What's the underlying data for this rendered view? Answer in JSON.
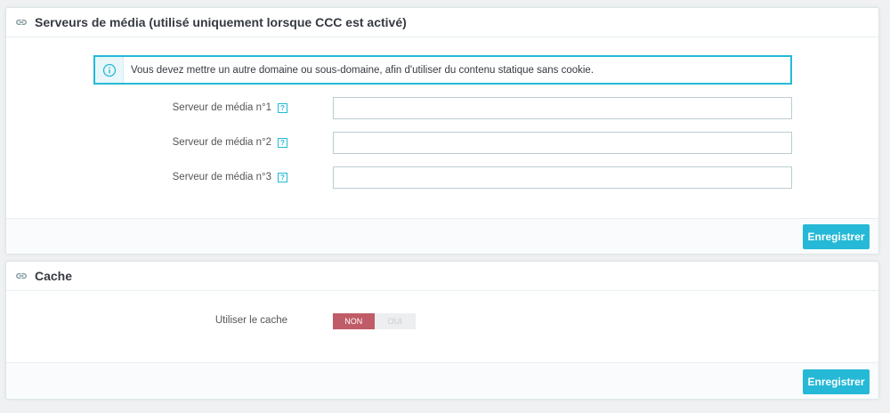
{
  "media_servers": {
    "title": "Serveurs de média (utilisé uniquement lorsque CCC est activé)",
    "alert": "Vous devez mettre un autre domaine ou sous-domaine, afin d'utiliser du contenu statique sans cookie.",
    "fields": [
      {
        "label": "Serveur de média n°1",
        "help": "?",
        "value": ""
      },
      {
        "label": "Serveur de média n°2",
        "help": "?",
        "value": ""
      },
      {
        "label": "Serveur de média n°3",
        "help": "?",
        "value": ""
      }
    ],
    "save_label": "Enregistrer"
  },
  "cache": {
    "title": "Cache",
    "use_cache_label": "Utiliser le cache",
    "switch_off": "NON",
    "switch_on": "OUI",
    "selected": "NON",
    "save_label": "Enregistrer"
  },
  "colors": {
    "accent": "#25b9d7",
    "switch_off_active": "#c05c67",
    "background": "#eff1f2"
  },
  "icons": {
    "panel_head": "link-icon",
    "alert": "info-icon",
    "field_help": "help-icon"
  }
}
